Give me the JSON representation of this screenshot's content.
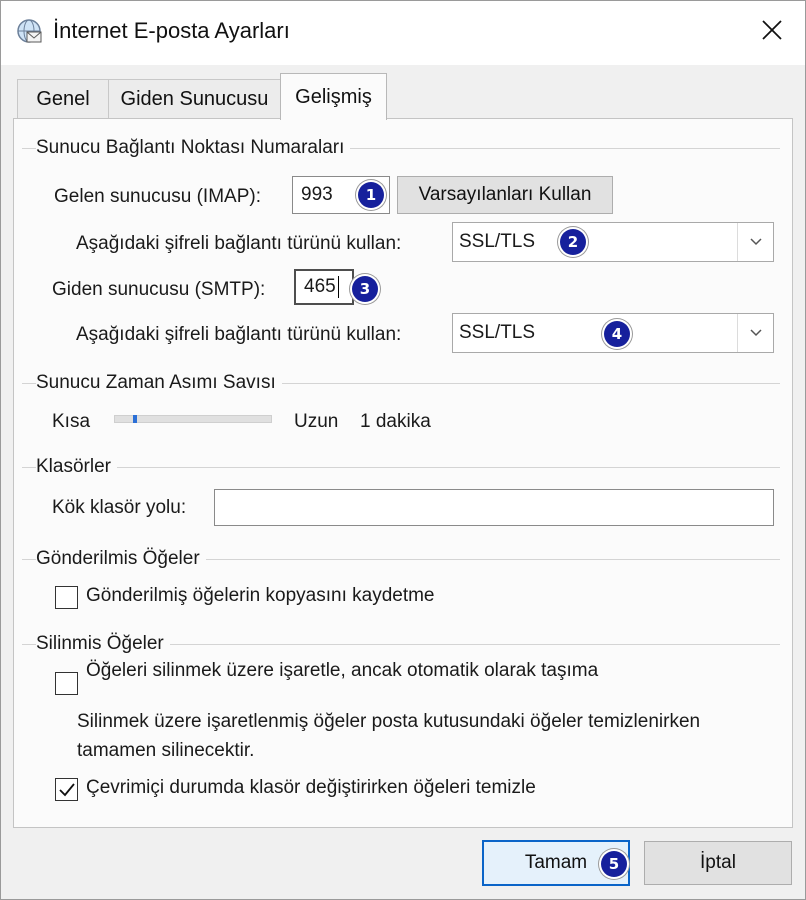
{
  "window": {
    "title": "İnternet E-posta Ayarları",
    "close_glyph": "✕"
  },
  "tabs": [
    {
      "label": "Genel",
      "active": false
    },
    {
      "label": "Giden Sunucusu",
      "active": false
    },
    {
      "label": "Gelişmiş",
      "active": true
    }
  ],
  "ports": {
    "group_title": "Sunucu Bağlantı Noktası Numaraları",
    "incoming_label": "Gelen sunucusu (IMAP):",
    "incoming_value": "993",
    "defaults_button": "Varsayılanları Kullan",
    "incoming_enc_label": "Aşağıdaki şifreli bağlantı türünü kullan:",
    "incoming_enc_value": "SSL/TLS",
    "outgoing_label": "Giden sunucusu (SMTP):",
    "outgoing_value": "465",
    "outgoing_enc_label": "Aşağıdaki şifreli bağlantı türünü kullan:",
    "outgoing_enc_value": "SSL/TLS"
  },
  "timeout": {
    "group_title": "Sunucu Zaman Asımı Savısı",
    "short_label": "Kısa",
    "long_label": "Uzun",
    "value_text": "1 dakika",
    "slider_fraction": 0.05
  },
  "folders": {
    "group_title": "Klasörler",
    "root_label": "Kök klasör yolu:",
    "root_value": ""
  },
  "sent": {
    "group_title": "Gönderilmis Öğeler",
    "no_copy_label": "Gönderilmiş öğelerin kopyasını kaydetme",
    "no_copy_checked": false
  },
  "deleted": {
    "group_title": "Silinmis Öğeler",
    "mark_label": "Öğeleri silinmek üzere işaretle, ancak otomatik olarak taşıma",
    "mark_checked": false,
    "info_line1": "Silinmek üzere işaretlenmiş öğeler posta kutusundaki öğeler temizlenirken",
    "info_line2": "tamamen silinecektir.",
    "purge_label": "Çevrimiçi durumda klasör değiştirirken öğeleri temizle",
    "purge_checked": true
  },
  "footer": {
    "ok_label": "Tamam",
    "cancel_label": "İptal"
  },
  "annotations": [
    "1",
    "2",
    "3",
    "4",
    "5"
  ],
  "colors": {
    "badge": "#16209c",
    "default_button_border": "#0a64c8"
  }
}
